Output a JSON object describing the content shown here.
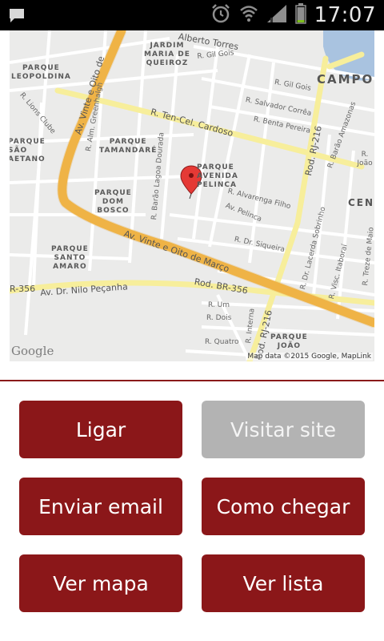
{
  "status_bar": {
    "time": "17:07",
    "icons": [
      "notification-icon",
      "alarm-icon",
      "wifi-icon",
      "signal-icon",
      "battery-icon"
    ]
  },
  "map": {
    "attribution_logo": "Google",
    "attribution_text": "Map data ©2015 Google, MapLink",
    "labels": {
      "jardim": "JARDIM\nMARIA DE\nQUEIROZ",
      "parque_leopoldina": "PARQUE\nLEOPOLDINA",
      "parque_tamandare": "PARQUE\nTAMANDARÉ",
      "parque_sao_caetano": "PARQUE\nSÃO\nAETANO",
      "parque_dom_bosco": "PARQUE\nDOM\nBOSCO",
      "parque_santo_amaro": "PARQUE\nSANTO\nAMARO",
      "parque_avenida_pelinca": "PARQUE\nAVENIDA\nPELINCA",
      "parque_joao": "PARQUE\nJOÃO",
      "campos": "CAMPO",
      "cent": "CENT",
      "av_vinte": "Av. Vinte e Oito de Março",
      "av_vinte_2": "Av. Vinte e Oito de",
      "ten_cel": "R. Ten-Cel. Cardoso",
      "rod_br": "Rod. BR-356",
      "br356_left": "R-356",
      "nilo": "Av. Dr. Nilo Peçanha",
      "rj216": "Rod. RJ-216",
      "rj216b": "Rod. RJ-216",
      "alberto": "Alberto Torres",
      "gil_gois": "R. Gil Gois",
      "gil_gois2": "R. Gil Gois",
      "salvador": "R. Salvador Corrêa",
      "benta": "R. Benta Pereira",
      "lions": "R. Lions Clube",
      "greenhalgh": "R. Alm. Greenhalgh",
      "lagoa": "R. Barão Lagoa Dourada",
      "alvarenga": "R. Alvarenga Filho",
      "pelinca": "Av. Pelinca",
      "siqueira": "R. Dr. Siqueira",
      "lacerda": "R. Dr. Lacerda Sobrinho",
      "itaboral": "R. Visc. Itaboraí",
      "amazonas": "R. Barão Amazonas",
      "treze": "R. Treze de Maio",
      "um": "R. Um",
      "dois": "R. Dois",
      "quatro": "R. Quatro",
      "interna": "R. Interna",
      "joao": "R. João"
    }
  },
  "actions": {
    "call": "Ligar",
    "visit_site": "Visitar site",
    "send_email": "Enviar email",
    "directions": "Como chegar",
    "view_map": "Ver mapa",
    "view_list": "Ver lista"
  },
  "colors": {
    "accent": "#8b1719",
    "disabled": "#b3b3b3",
    "major_road": "#f5b94a",
    "secondary_road": "#f7ee9b"
  }
}
